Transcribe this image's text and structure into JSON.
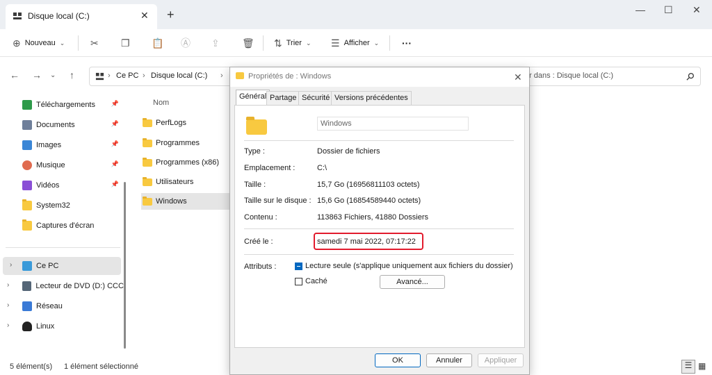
{
  "tab": {
    "title": "Disque local (C:)",
    "close": "✕",
    "new": "+"
  },
  "window_controls": {
    "minimize": "—",
    "maximize": "☐",
    "close": "✕"
  },
  "toolbar": {
    "new_label": "Nouveau",
    "sort_label": "Trier",
    "view_label": "Afficher",
    "more": "···"
  },
  "address": {
    "crumbs": [
      "Ce PC",
      "Disque local (C:)"
    ],
    "separator": "›",
    "search_placeholder": "r dans : Disque local (C:)"
  },
  "sidebar": {
    "quick": [
      {
        "label": "Téléchargements",
        "icon": "download-icon",
        "color": "#2e9a4a",
        "pinned": true
      },
      {
        "label": "Documents",
        "icon": "document-icon",
        "color": "#6f7f9a",
        "pinned": true
      },
      {
        "label": "Images",
        "icon": "image-icon",
        "color": "#3a86d6",
        "pinned": true
      },
      {
        "label": "Musique",
        "icon": "music-icon",
        "color": "#e06b4f",
        "pinned": true
      },
      {
        "label": "Vidéos",
        "icon": "video-icon",
        "color": "#8a4fd6",
        "pinned": true
      },
      {
        "label": "System32",
        "icon": "folder-icon",
        "color": "#f8c940",
        "pinned": false
      },
      {
        "label": "Captures d'écran",
        "icon": "folder-icon",
        "color": "#f8c940",
        "pinned": false
      }
    ],
    "tree": [
      {
        "label": "Ce PC",
        "icon": "computer-icon",
        "color": "#3a9ad9",
        "selected": true
      },
      {
        "label": "Lecteur de DVD (D:) CCCC",
        "icon": "dvd-icon",
        "color": "#556677",
        "selected": false
      },
      {
        "label": "Réseau",
        "icon": "network-icon",
        "color": "#3a7ad6",
        "selected": false
      },
      {
        "label": "Linux",
        "icon": "linux-icon",
        "color": "#222222",
        "selected": false
      }
    ]
  },
  "filelist": {
    "header": "Nom",
    "items": [
      {
        "name": "PerfLogs",
        "selected": false
      },
      {
        "name": "Programmes",
        "selected": false
      },
      {
        "name": "Programmes (x86)",
        "selected": false
      },
      {
        "name": "Utilisateurs",
        "selected": false
      },
      {
        "name": "Windows",
        "selected": true
      }
    ]
  },
  "status": {
    "count": "5 élément(s)",
    "selection": "1 élément sélectionné"
  },
  "dialog": {
    "title": "Propriétés de : Windows",
    "tabs": [
      "Général",
      "Partage",
      "Sécurité",
      "Versions précédentes"
    ],
    "name_value": "Windows",
    "rows": [
      {
        "label": "Type :",
        "value": "Dossier de fichiers"
      },
      {
        "label": "Emplacement :",
        "value": "C:\\"
      },
      {
        "label": "Taille :",
        "value": "15,7 Go (16956811103 octets)"
      },
      {
        "label": "Taille sur le disque :",
        "value": "15,6 Go (16854589440 octets)"
      },
      {
        "label": "Contenu :",
        "value": "113863 Fichiers, 41880 Dossiers"
      }
    ],
    "created_label": "Créé le :",
    "created_value": "samedi 7 mai 2022, 07:17:22",
    "attributes_label": "Attributs :",
    "readonly_label": "Lecture seule (s'applique uniquement aux fichiers du dossier)",
    "hidden_label": "Caché",
    "advanced_label": "Avancé...",
    "ok_label": "OK",
    "cancel_label": "Annuler",
    "apply_label": "Appliquer",
    "highlight_color": "#e21b2d"
  }
}
